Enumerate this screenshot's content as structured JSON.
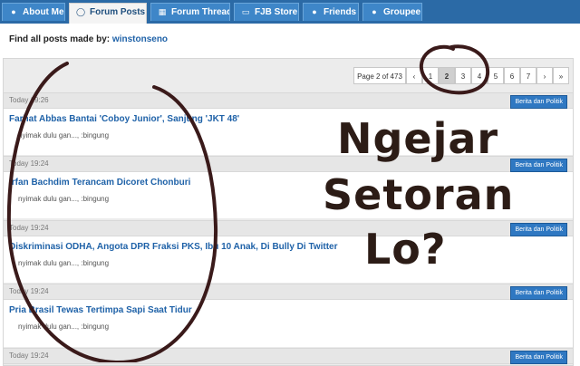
{
  "tabs": [
    {
      "label": "About Me",
      "icon": "bulb-icon"
    },
    {
      "label": "Forum Posts",
      "icon": "speech-bubble-icon"
    },
    {
      "label": "Forum Thread",
      "icon": "calendar-icon"
    },
    {
      "label": "FJB Store",
      "icon": "monitor-icon"
    },
    {
      "label": "Friends",
      "icon": "bulb-icon"
    },
    {
      "label": "Groupee",
      "icon": "bulb-icon"
    }
  ],
  "find": {
    "label": "Find all posts made by:",
    "username": "winstonseno"
  },
  "pager": {
    "info": "Page 2 of 473",
    "prev": "‹",
    "pages": [
      "1",
      "2",
      "3",
      "4",
      "5",
      "6",
      "7"
    ],
    "current": "2",
    "next": "›",
    "last": "»"
  },
  "posts": [
    {
      "date": "Today 19:26",
      "category": "Berita dan Politik",
      "title": "Farhat Abbas Bantai 'Coboy Junior', Sanjung 'JKT 48'",
      "snippet": "nyimak dulu gan..., :bingung"
    },
    {
      "date": "Today 19:24",
      "category": "Berita dan Politik",
      "title": "Irfan Bachdim Terancam Dicoret Chonburi",
      "snippet": "nyimak dulu gan..., :bingung"
    },
    {
      "date": "Today 19:24",
      "category": "Berita dan Politik",
      "title": "Diskriminasi ODHA, Angota DPR Fraksi PKS, Ibu 10 Anak, Di Bully Di Twitter",
      "snippet": "nyimak dulu gan..., :bingung"
    },
    {
      "date": "Today 19:24",
      "category": "Berita dan Politik",
      "title": "Pria Brasil Tewas Tertimpa Sapi Saat Tidur",
      "snippet": "nyimak dulu gan..., :bingung"
    },
    {
      "date": "Today 19:24",
      "category": "Berita dan Politik",
      "title": "",
      "snippet": ""
    }
  ],
  "overlay": {
    "line1": "Ngejar",
    "line2": "Setoran",
    "line3": "Lo?"
  },
  "colors": {
    "tabbar": "#2b6aa6",
    "link": "#1f62a8",
    "ink": "#2c1c16"
  }
}
